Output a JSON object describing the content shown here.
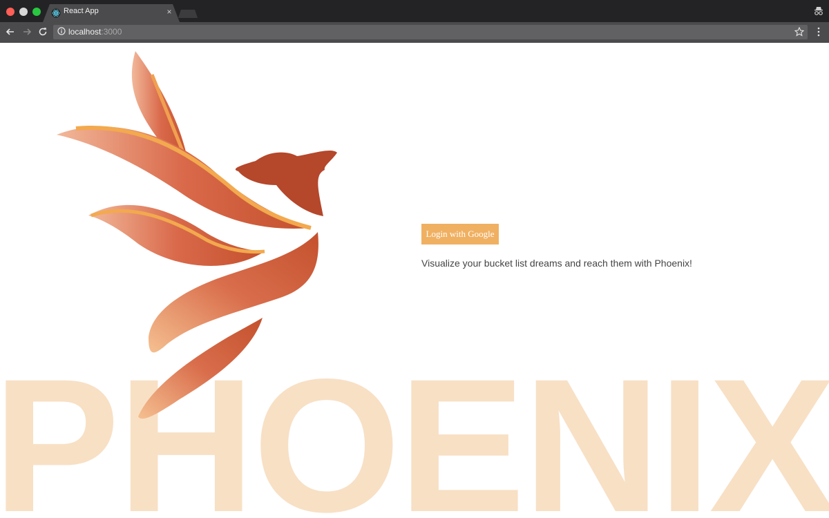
{
  "browser": {
    "tab": {
      "title": "React App",
      "favicon": "react-icon",
      "close": "×"
    },
    "address_bar": {
      "host": "localhost",
      "port": ":3000"
    },
    "icons": [
      "back-icon",
      "forward-icon",
      "reload-icon",
      "info-icon",
      "star-icon",
      "menu-icon",
      "incognito-icon"
    ]
  },
  "page": {
    "login_button": "Login with Google",
    "tagline": "Visualize your bucket list dreams and reach them with Phoenix!",
    "wordmark": "PHOENIX",
    "logo": "phoenix-logo"
  },
  "colors": {
    "button_bg": "#f0b062",
    "wordmark": "#f8e0c5",
    "phoenix_dark": "#b5472b",
    "phoenix_orange": "#e8a050"
  }
}
